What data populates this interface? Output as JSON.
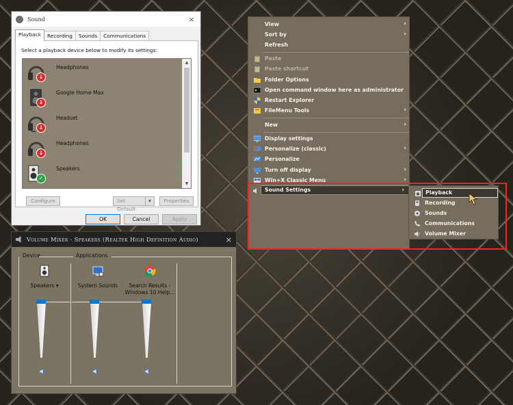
{
  "sound_dialog": {
    "title": "Sound",
    "close_glyph": "×",
    "tabs": [
      {
        "label": "Playback",
        "active": true
      },
      {
        "label": "Recording",
        "active": false
      },
      {
        "label": "Sounds",
        "active": false
      },
      {
        "label": "Communications",
        "active": false
      }
    ],
    "instruction": "Select a playback device below to modify its settings:",
    "devices": [
      {
        "name": "Headphones",
        "icon": "headphones-icon",
        "status": "disconnected"
      },
      {
        "name": "Google Home Max",
        "icon": "speaker-box-icon",
        "status": "disconnected"
      },
      {
        "name": "Headset",
        "icon": "headset-icon",
        "status": "disconnected"
      },
      {
        "name": "Headphones",
        "icon": "headphones-icon",
        "status": "disconnected"
      },
      {
        "name": "Speakers",
        "icon": "speakers-icon",
        "status": "default"
      }
    ],
    "buttons": {
      "configure": "Configure",
      "set_default": "Set Default",
      "properties": "Properties",
      "ok": "OK",
      "cancel": "Cancel",
      "apply": "Apply"
    }
  },
  "volume_mixer": {
    "title": "Volume Mixer - Speakers (Realtek High Definition Audio)",
    "close_glyph": "×",
    "device_label": "Device",
    "applications_label": "Applications",
    "columns": [
      {
        "name": "Speakers",
        "has_dropdown": true,
        "icon": "speakers-icon",
        "level": 1.0
      },
      {
        "name": "System Sounds",
        "has_dropdown": false,
        "icon": "system-sounds-icon",
        "level": 1.0
      },
      {
        "name": "Search Results - Windows 10 Help...",
        "has_dropdown": false,
        "icon": "chrome-icon",
        "level": 1.0
      }
    ]
  },
  "context_menu": {
    "items": [
      {
        "label": "View",
        "submenu": true,
        "disabled": false,
        "icon": ""
      },
      {
        "label": "Sort by",
        "submenu": true,
        "disabled": false,
        "icon": ""
      },
      {
        "label": "Refresh",
        "submenu": false,
        "disabled": false,
        "icon": ""
      },
      {
        "label": "Paste",
        "submenu": false,
        "disabled": true,
        "icon": "paste-icon"
      },
      {
        "label": "Paste shortcut",
        "submenu": false,
        "disabled": true,
        "icon": "paste-shortcut-icon"
      },
      {
        "label": "Folder Options",
        "submenu": false,
        "disabled": false,
        "icon": "folder-icon"
      },
      {
        "label": "Open command window here as administrator",
        "submenu": false,
        "disabled": false,
        "icon": "cmd-icon"
      },
      {
        "label": "Restart Explorer",
        "submenu": false,
        "disabled": false,
        "icon": "shield-icon"
      },
      {
        "label": "FileMenu Tools",
        "submenu": true,
        "disabled": false,
        "icon": "filemenu-icon"
      },
      {
        "label": "New",
        "submenu": true,
        "disabled": false,
        "icon": ""
      },
      {
        "label": "Display settings",
        "submenu": false,
        "disabled": false,
        "icon": "display-icon"
      },
      {
        "label": "Personalize (classic)",
        "submenu": true,
        "disabled": false,
        "icon": "personalize-classic-icon"
      },
      {
        "label": "Personalize",
        "submenu": false,
        "disabled": false,
        "icon": "personalize-icon"
      },
      {
        "label": "Turn off display",
        "submenu": true,
        "disabled": false,
        "icon": "monitor-off-icon"
      },
      {
        "label": "Win+X Classic Menu",
        "submenu": true,
        "disabled": false,
        "icon": "winx-icon"
      },
      {
        "label": "Sound Settings",
        "submenu": true,
        "disabled": false,
        "icon": "sound-icon",
        "highlighted": true
      }
    ]
  },
  "sound_submenu": {
    "items": [
      {
        "label": "Playback",
        "icon": "playback-icon",
        "active": true
      },
      {
        "label": "Recording",
        "icon": "microphone-icon",
        "active": false
      },
      {
        "label": "Sounds",
        "icon": "sounds-icon",
        "active": false
      },
      {
        "label": "Communications",
        "icon": "phone-icon",
        "active": false
      },
      {
        "label": "Volume Mixer",
        "icon": "volume-mixer-icon",
        "active": false
      }
    ]
  },
  "colors": {
    "accent": "#0078d7",
    "highlight_box": "#ff1f1f",
    "menu_bg": "#766d5f"
  }
}
